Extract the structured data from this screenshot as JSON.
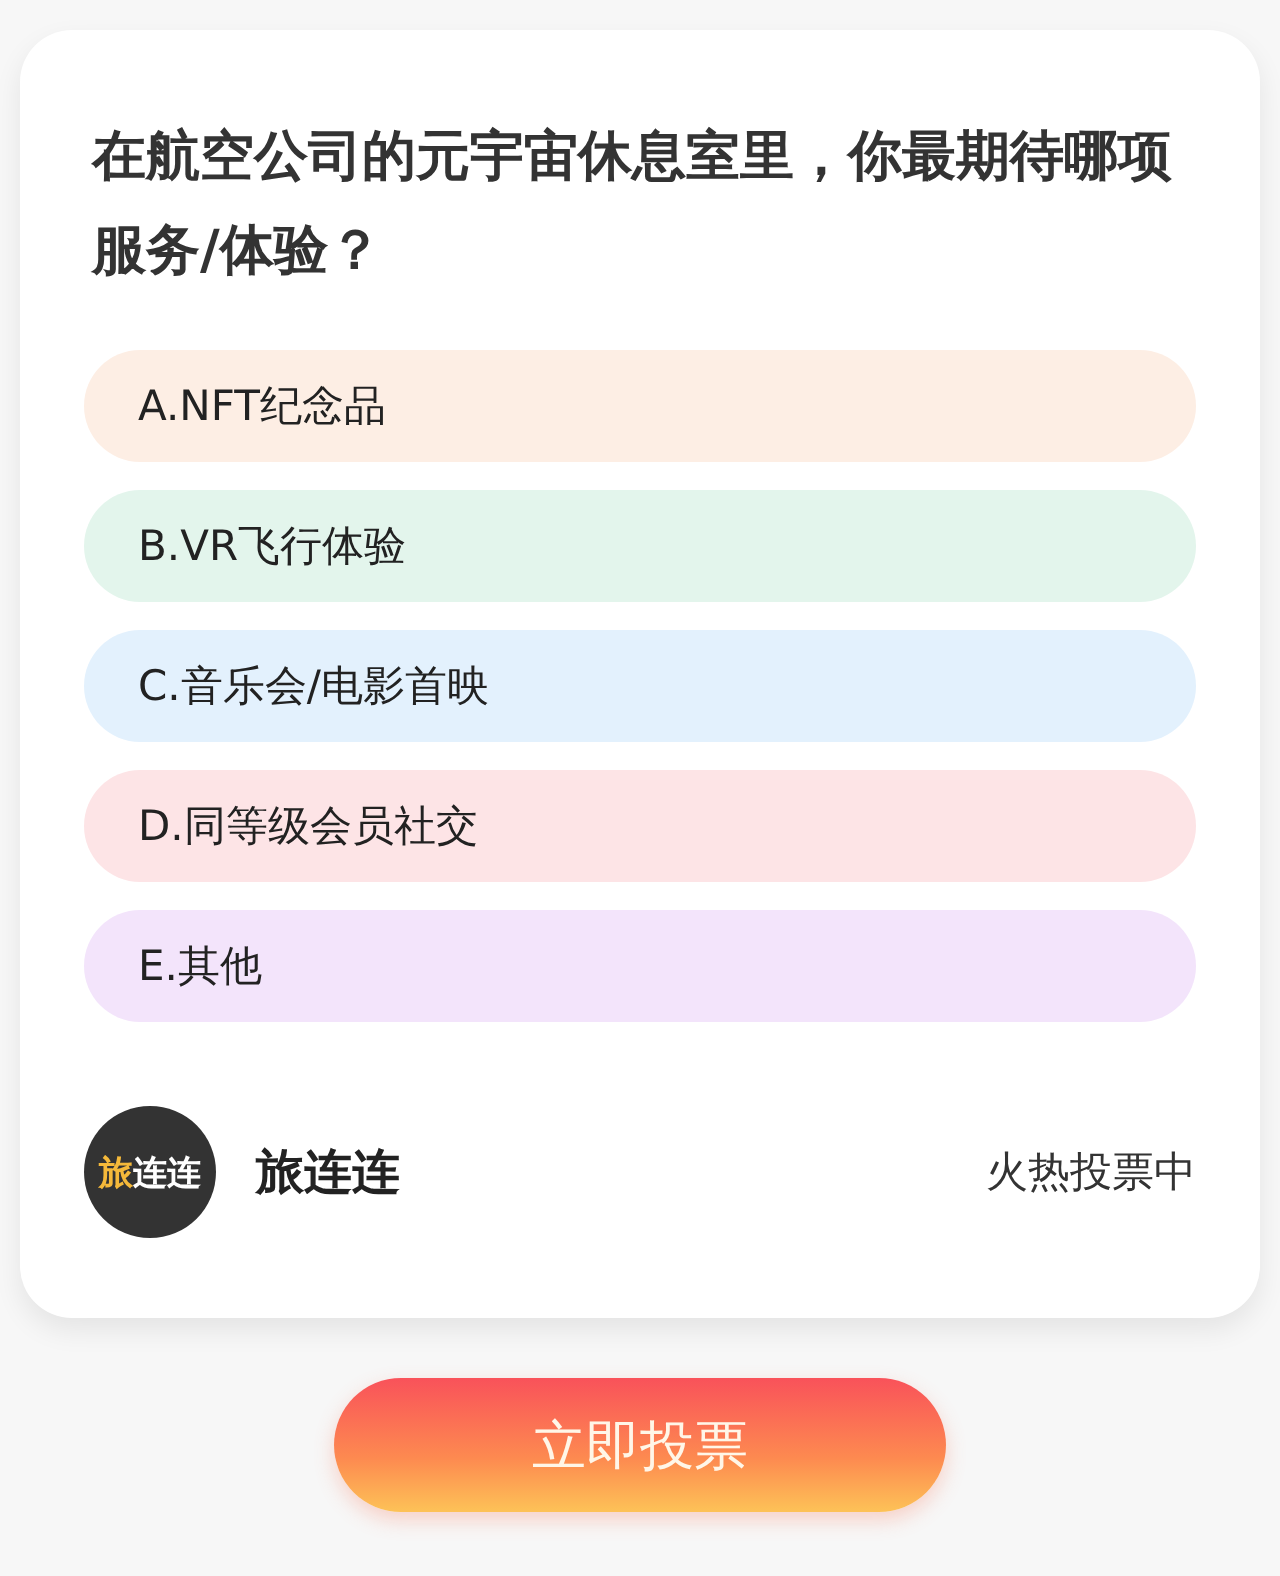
{
  "question": "在航空公司的元宇宙休息室里，你最期待哪项服务/体验？",
  "options": [
    {
      "label": "A.NFT纪念品",
      "color": "#fdeee4"
    },
    {
      "label": "B.VR飞行体验",
      "color": "#e3f5ec"
    },
    {
      "label": "C.音乐会/电影首映",
      "color": "#e3f1fd"
    },
    {
      "label": "D.同等级会员社交",
      "color": "#fde4e6"
    },
    {
      "label": "E.其他",
      "color": "#f3e4fb"
    }
  ],
  "author": {
    "logo": {
      "highlight": "旅",
      "rest": "连连"
    },
    "name": "旅连连"
  },
  "status": "火热投票中",
  "vote_button": "立即投票"
}
